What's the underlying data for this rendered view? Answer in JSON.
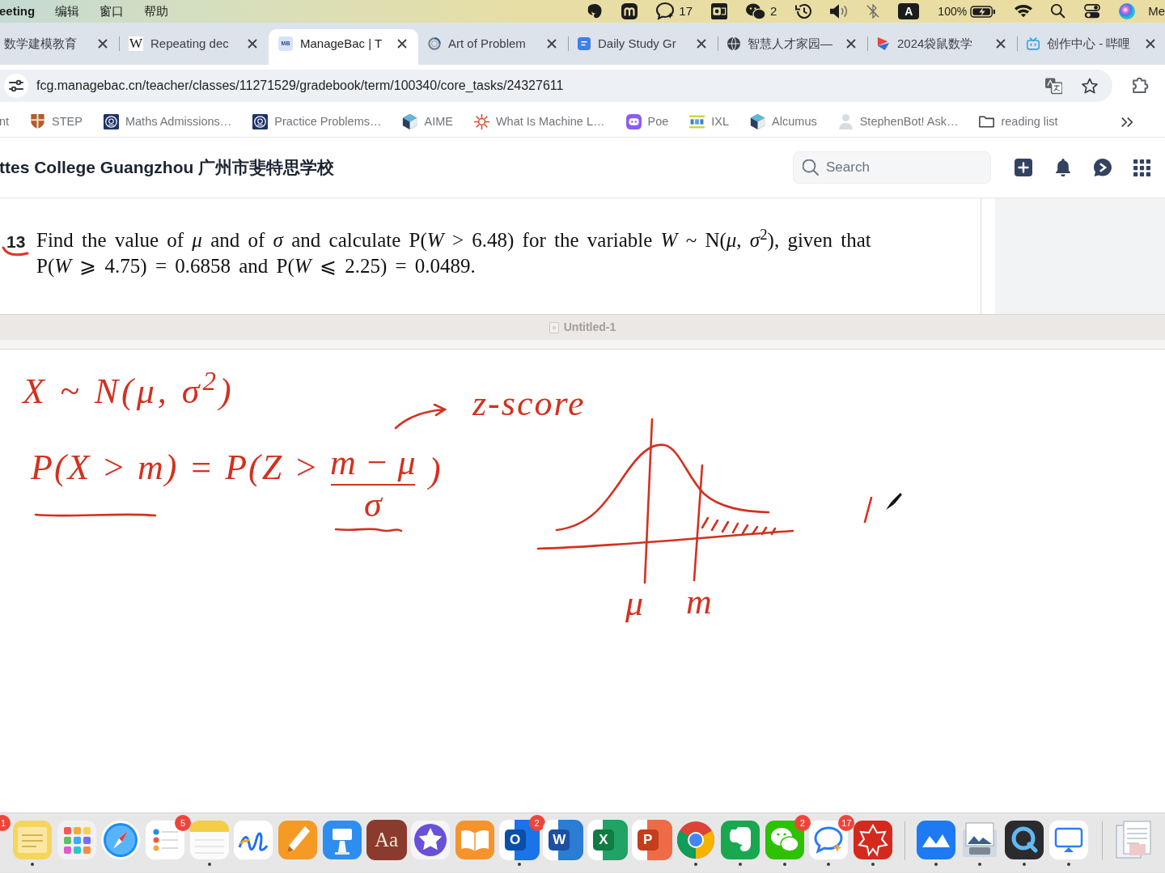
{
  "menu_bar": {
    "app_menus": [
      "eeting",
      "编辑",
      "窗口",
      "帮助"
    ],
    "status": {
      "chat_count": "17",
      "wechat_count": "2",
      "input_source": "A",
      "battery_percent": "100%",
      "user": "Me"
    }
  },
  "tabs": [
    {
      "label": "数学建模教育",
      "selected": false
    },
    {
      "label": "Repeating dec",
      "selected": false,
      "icon_text": "W"
    },
    {
      "label": "ManageBac | T",
      "selected": true,
      "icon_text": "MB"
    },
    {
      "label": "Art of Problem",
      "selected": false
    },
    {
      "label": "Daily Study Gr",
      "selected": false
    },
    {
      "label": "智慧人才家园—",
      "selected": false
    },
    {
      "label": "2024袋鼠数学",
      "selected": false
    },
    {
      "label": "创作中心 - 哔哩",
      "selected": false
    }
  ],
  "address_bar": {
    "url": "fcg.managebac.cn/teacher/classes/11271529/gradebook/term/100340/core_tasks/24327611"
  },
  "bookmarks": [
    "nt",
    "STEP",
    "Maths Admissions…",
    "Practice Problems…",
    "AIME",
    "What Is Machine L…",
    "Poe",
    "IXL",
    "Alcumus",
    "StephenBot! Ask…",
    "reading list"
  ],
  "page_header": {
    "school": "ttes College Guangzhou 广州市斐特思学校",
    "search": {
      "placeholder": "Search"
    }
  },
  "question": {
    "number": "13",
    "text": "Find the value of *μ* and of *σ* and calculate P(*W* > 6.48) for the variable *W* ~ N(*μ*, *σ*$^{2}$), given that P(*W* ⩾ 4.75) = 0.6858 and P(*W* ⩽ 2.25) = 0.0489."
  },
  "drawing_window": {
    "title": "Untitled-1",
    "notes": {
      "distribution": "X ~ N(μ, σ$^{2}$)",
      "arrow_label": "z-score",
      "equation": "P(X > m) = P(Z >",
      "numerator": "m − μ",
      "denominator": "σ",
      "closing": ")",
      "axis_labels": [
        "μ",
        "m"
      ]
    }
  },
  "dock": {
    "edge_badge": "1",
    "app_groups": [
      [
        {
          "running": true
        },
        {
          "running": false
        },
        {
          "running": false
        },
        {
          "running": false,
          "badge": "5"
        },
        {
          "running": true
        },
        {
          "running": false
        },
        {
          "running": false
        },
        {
          "running": false
        },
        {
          "running": false,
          "glyph": "Aa"
        },
        {
          "running": false
        },
        {
          "running": false
        },
        {
          "running": true,
          "badge": "2",
          "glyph": "O"
        },
        {
          "running": false,
          "glyph": "W"
        },
        {
          "running": false,
          "glyph": "X"
        },
        {
          "running": false,
          "glyph": "P"
        },
        {
          "running": true
        },
        {
          "running": true
        },
        {
          "running": true,
          "badge": "2"
        },
        {
          "running": true,
          "badge": "17"
        },
        {
          "running": true
        }
      ],
      [
        {
          "running": true
        },
        {
          "running": true
        },
        {
          "running": true
        },
        {
          "running": true
        }
      ],
      [
        {
          "running": false
        }
      ]
    ]
  }
}
